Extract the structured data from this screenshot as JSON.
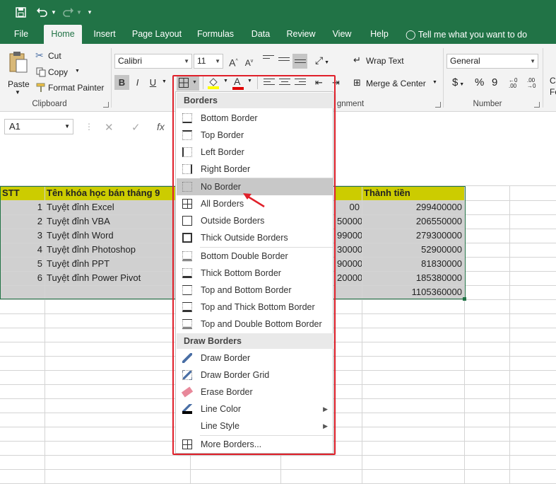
{
  "qat": {
    "save_icon": "save-icon",
    "undo_icon": "undo-icon",
    "redo_icon": "redo-icon",
    "customize_icon": "chevron-down-icon"
  },
  "tabs": [
    {
      "label": "File"
    },
    {
      "label": "Home"
    },
    {
      "label": "Insert"
    },
    {
      "label": "Page Layout"
    },
    {
      "label": "Formulas"
    },
    {
      "label": "Data"
    },
    {
      "label": "Review"
    },
    {
      "label": "View"
    },
    {
      "label": "Help"
    }
  ],
  "tell_me": "Tell me what you want to do",
  "clipboard": {
    "paste": "Paste",
    "cut": "Cut",
    "copy": "Copy",
    "format_painter": "Format Painter",
    "group": "Clipboard"
  },
  "font": {
    "name": "Calibri",
    "size": "11",
    "bold": "B",
    "italic": "I",
    "underline": "U",
    "grow": "A",
    "shrink": "A"
  },
  "alignment": {
    "wrap_text": "Wrap Text",
    "merge_center": "Merge & Center",
    "group": "gnment"
  },
  "number": {
    "format": "General",
    "currency": "$",
    "percent": "%",
    "comma": "9",
    "group": "Number"
  },
  "styles_cut": {
    "line1": "C",
    "line2": "Fo"
  },
  "formula_bar": {
    "namebox": "A1",
    "cancel": "✕",
    "enter": "✓",
    "fx": "fx"
  },
  "sheet": {
    "headers": {
      "stt": "STT",
      "course": "Tên khóa học bán tháng 9",
      "total": "Thành tiền"
    },
    "rows": [
      {
        "stt": "1",
        "course": "Tuyệt đỉnh Excel",
        "partial": "00",
        "total": "299400000"
      },
      {
        "stt": "2",
        "course": "Tuyệt đỉnh VBA",
        "partial": "50000",
        "total": "206550000"
      },
      {
        "stt": "3",
        "course": "Tuyệt đỉnh Word",
        "partial": "99000",
        "total": "279300000"
      },
      {
        "stt": "4",
        "course": "Tuyệt đỉnh Photoshop",
        "partial": "30000",
        "total": "52900000"
      },
      {
        "stt": "5",
        "course": "Tuyệt đỉnh PPT",
        "partial": "90000",
        "total": "81830000"
      },
      {
        "stt": "6",
        "course": "Tuyệt đỉnh Power Pivot",
        "partial": "20000",
        "total": "185380000"
      }
    ],
    "grand_total": "1105360000"
  },
  "menu": {
    "section_borders": "Borders",
    "items1": [
      {
        "label": "Bottom Border"
      },
      {
        "label": "Top Border"
      },
      {
        "label": "Left Border"
      },
      {
        "label": "Right Border"
      },
      {
        "label": "No Border"
      },
      {
        "label": "All Borders"
      },
      {
        "label": "Outside Borders"
      },
      {
        "label": "Thick Outside Borders"
      }
    ],
    "items2": [
      {
        "label": "Bottom Double Border"
      },
      {
        "label": "Thick Bottom Border"
      },
      {
        "label": "Top and Bottom Border"
      },
      {
        "label": "Top and Thick Bottom Border"
      },
      {
        "label": "Top and Double Bottom Border"
      }
    ],
    "section_draw": "Draw Borders",
    "items3": [
      {
        "label": "Draw Border"
      },
      {
        "label": "Draw Border Grid"
      },
      {
        "label": "Erase Border"
      },
      {
        "label": "Line Color"
      },
      {
        "label": "Line Style"
      }
    ],
    "more": "More Borders...",
    "submenu_arrow": "▶",
    "highlight_color": "#c8c8c8",
    "annotation_color": "#e0202a"
  }
}
